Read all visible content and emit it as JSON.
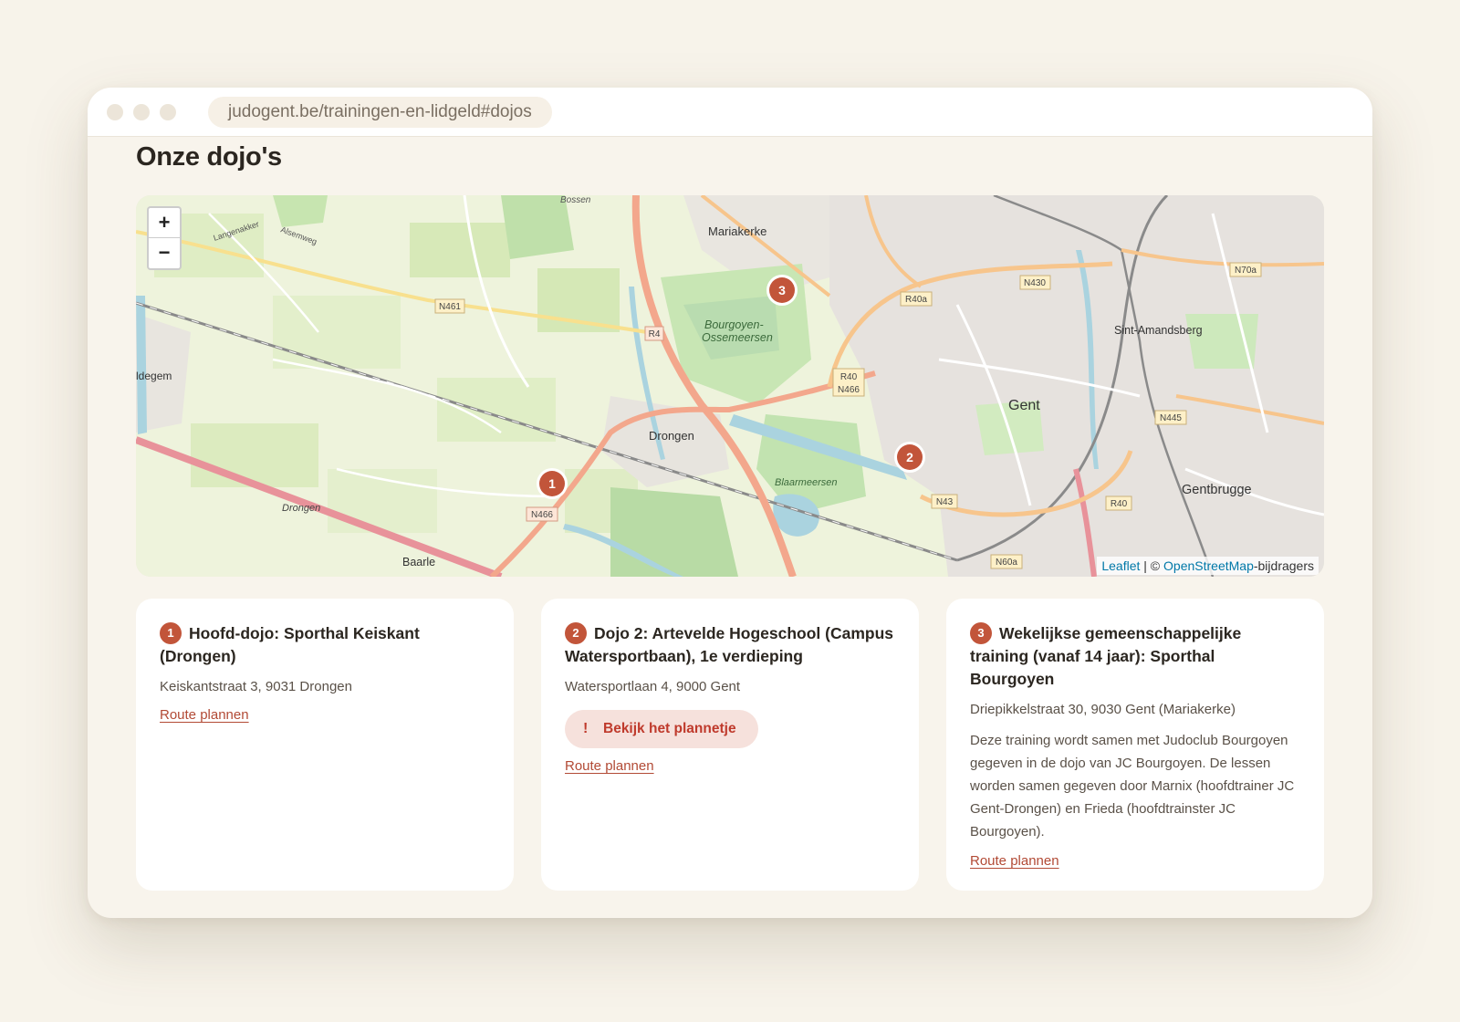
{
  "browser": {
    "url": "judogent.be/trainingen-en-lidgeld#dojos"
  },
  "page": {
    "title": "Onze dojo's"
  },
  "map": {
    "zoom_in": "+",
    "zoom_out": "−",
    "markers": [
      "1",
      "2",
      "3"
    ],
    "attribution": {
      "leaflet": "Leaflet",
      "separator": " | © ",
      "osm": "OpenStreetMap",
      "suffix": "-bijdragers"
    },
    "place_labels": {
      "mariakerke": "Mariakerke",
      "sint_amandsberg": "Sint-Amandsberg",
      "gent": "Gent",
      "drongen": "Drongen",
      "drongen_small": "Drongen",
      "gentbrugge": "Gentbrugge",
      "baarle": "Baarle",
      "bourgoyen": "Bourgoyen-",
      "ossemeersen": "Ossemeersen",
      "blaarmeersen": "Blaarmeersen",
      "edge_west": "ldegem",
      "bossen": "Bossen",
      "langenakker": "Langenakker",
      "alsemweg": "Alsemweg"
    },
    "road_labels": {
      "n461": "N461",
      "r4": "R4",
      "n430": "N430",
      "n70a": "N70a",
      "r40a": "R40a",
      "r40": "R40",
      "n466_a": "N466",
      "n445": "N445",
      "n43": "N43",
      "r40_b": "R40",
      "n466_b": "N466",
      "n60a": "N60a"
    },
    "colors": {
      "marker": "#c2553a",
      "motorway": "#e8929a",
      "trunk": "#f3a78c",
      "primary": "#f7c58c",
      "water": "#aad3df",
      "park": "#c8e6b4",
      "farmland": "#eaf1d6"
    }
  },
  "dojos": [
    {
      "number": "1",
      "title": "Hoofd-dojo: Sporthal Keiskant (Drongen)",
      "address": "Keiskantstraat 3, 9031 Drongen",
      "route_label": "Route plannen"
    },
    {
      "number": "2",
      "title": "Dojo 2: Artevelde Hogeschool (Campus Watersportbaan), 1e verdieping",
      "address": "Watersportlaan 4, 9000 Gent",
      "plan_icon": "!",
      "plan_label": "Bekijk het plannetje",
      "route_label": "Route plannen"
    },
    {
      "number": "3",
      "title": "Wekelijkse gemeenschappelijke training (vanaf 14 jaar): Sporthal Bourgoyen",
      "address": "Driepikkelstraat 30, 9030 Gent (Mariakerke)",
      "description": "Deze training wordt samen met Judoclub Bourgoyen gegeven in de dojo van JC Bourgoyen. De lessen worden samen gegeven door Marnix (hoofdtrainer JC Gent-Drongen) en Frieda (hoofdtrainster JC Bourgoyen).",
      "route_label": "Route plannen"
    }
  ]
}
